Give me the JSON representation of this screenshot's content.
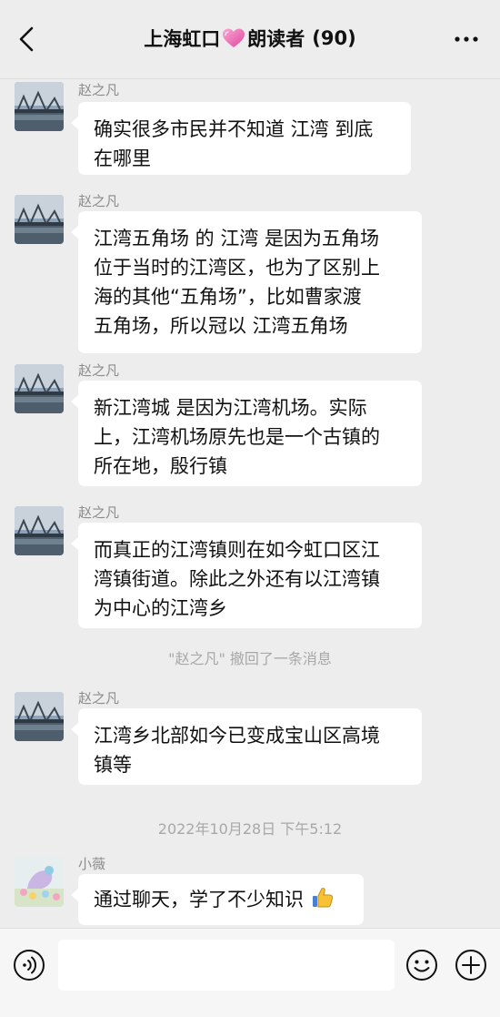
{
  "header": {
    "title_prefix": "上海虹口",
    "title_suffix": "朗读者",
    "member_count": "(90)"
  },
  "messages": [
    {
      "sender": "赵之凡",
      "lines": [
        "确实很多市民并不知道 江湾 到底",
        "在哪里"
      ]
    },
    {
      "sender": "赵之凡",
      "lines": [
        "江湾五角场 的 江湾 是因为五角场",
        "位于当时的江湾区，也为了区别上",
        "海的其他“五角场”，比如曹家渡",
        "五角场，所以冠以 江湾五角场"
      ]
    },
    {
      "sender": "赵之凡",
      "lines": [
        "新江湾城 是因为江湾机场。实际",
        "上，江湾机场原先也是一个古镇的",
        "所在地，殷行镇"
      ]
    },
    {
      "sender": "赵之凡",
      "lines": [
        "而真正的江湾镇则在如今虹口区江",
        "湾镇街道。除此之外还有以江湾镇",
        "为中心的江湾乡"
      ]
    },
    {
      "sender": "赵之凡",
      "lines": [
        "江湾乡北部如今已变成宝山区高境",
        "镇等"
      ]
    },
    {
      "sender": "小薇",
      "lines": [
        "通过聊天，学了不少知识"
      ]
    }
  ],
  "system": {
    "recall_notice": "\"赵之凡\" 撤回了一条消息",
    "timestamp": "2022年10月28日 下午5:12"
  },
  "icons": {
    "back": "chevron-left-icon",
    "more": "more-dots-icon",
    "heart": "heart-icon",
    "thumbs_up": "thumbs-up-icon",
    "voice": "voice-icon",
    "emoji": "emoji-icon",
    "plus": "plus-icon"
  },
  "colors": {
    "background": "#ededed",
    "bubble": "#ffffff",
    "heart": "#ee5fa7"
  }
}
